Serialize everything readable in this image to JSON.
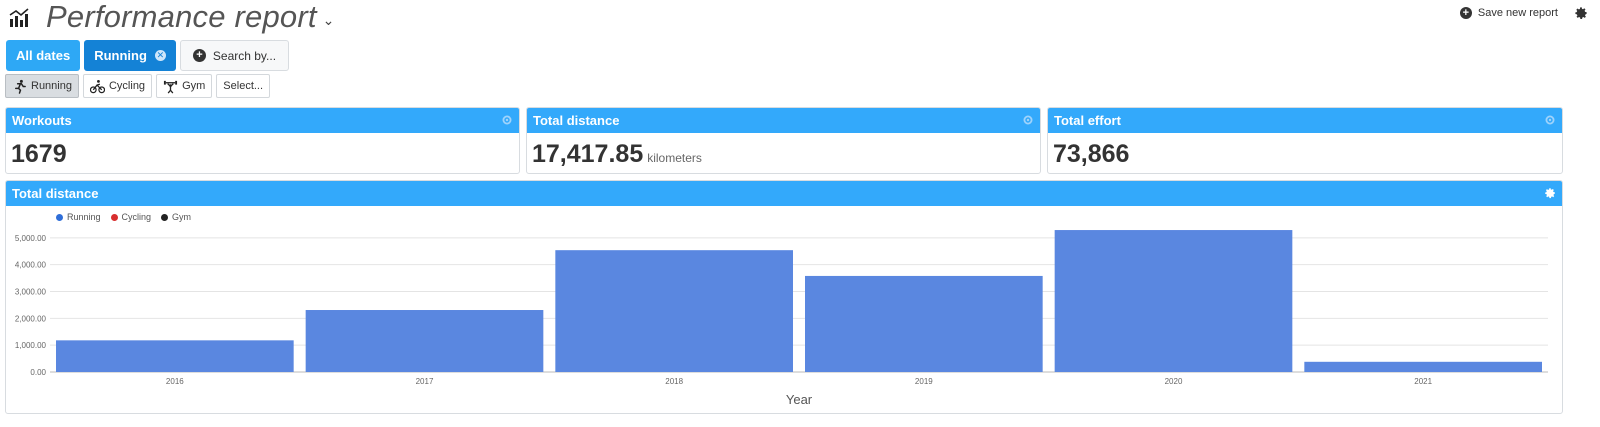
{
  "header": {
    "title": "Performance report",
    "save_label": "Save new report"
  },
  "filters": {
    "all_dates": "All dates",
    "running": "Running",
    "search_by": "Search by..."
  },
  "activities": [
    {
      "label": "Running",
      "icon": "running-icon",
      "active": true
    },
    {
      "label": "Cycling",
      "icon": "cycling-icon",
      "active": false
    },
    {
      "label": "Gym",
      "icon": "gym-icon",
      "active": false
    },
    {
      "label": "Select...",
      "icon": "",
      "active": false
    }
  ],
  "stats": {
    "workouts": {
      "title": "Workouts",
      "value": "1679"
    },
    "distance": {
      "title": "Total distance",
      "value": "17,417.85",
      "unit": "kilometers"
    },
    "effort": {
      "title": "Total effort",
      "value": "73,866"
    }
  },
  "colors": {
    "header_blue": "#33a9fb",
    "bar": "#5a87e0",
    "running": "#2f6ed8",
    "cycling": "#d82e2e",
    "gym": "#222222"
  },
  "chart_data": {
    "type": "bar",
    "title": "Total distance",
    "xlabel": "Year",
    "ylabel": "",
    "categories": [
      "2016",
      "2017",
      "2018",
      "2019",
      "2020",
      "2021"
    ],
    "series": [
      {
        "name": "Running",
        "values": [
          1180,
          2310,
          4540,
          3580,
          5290,
          380
        ]
      }
    ],
    "legend": [
      "Running",
      "Cycling",
      "Gym"
    ],
    "yticks": [
      "0.00",
      "1,000.00",
      "2,000.00",
      "3,000.00",
      "4,000.00",
      "5,000.00"
    ],
    "ylim": [
      0,
      6000
    ],
    "grid": true,
    "legend_position": "top-left"
  }
}
